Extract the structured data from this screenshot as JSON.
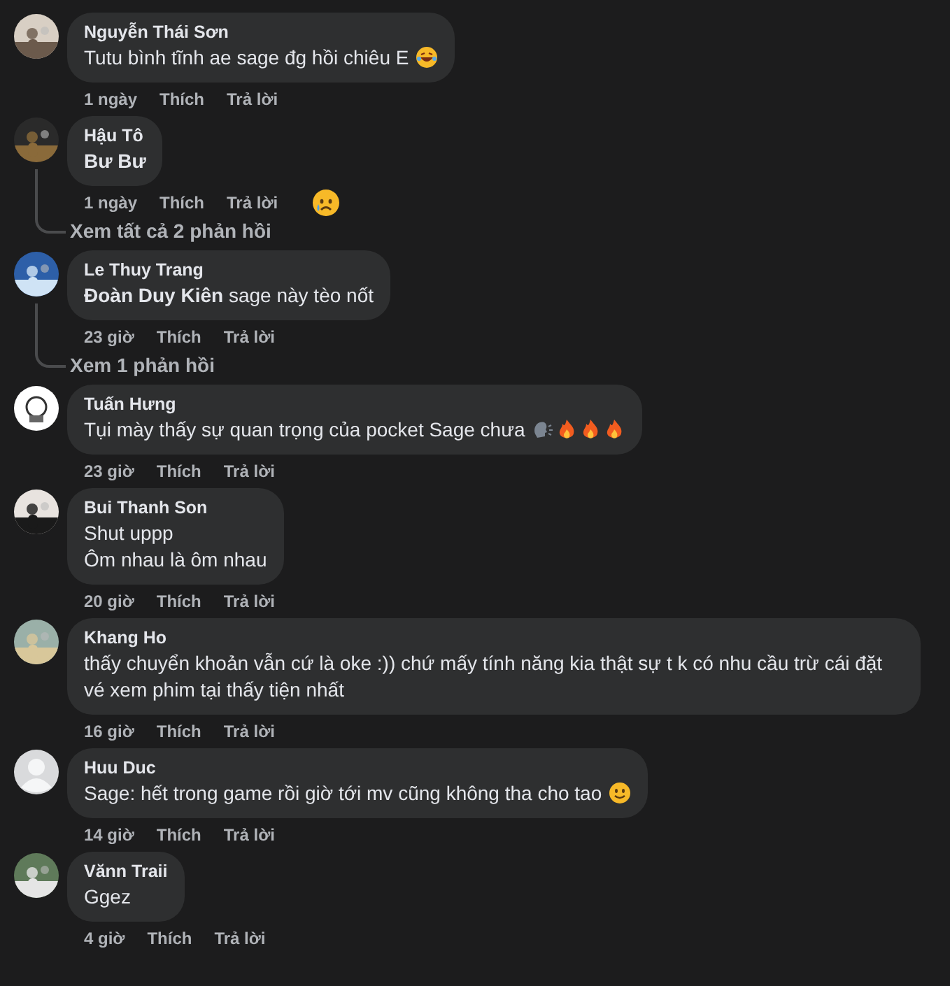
{
  "comments": [
    {
      "name": "Nguyễn Thái Sơn",
      "text": "Tutu bình tĩnh ae sage đg hồi chiêu E",
      "text_bold": false,
      "emojis": [
        {
          "kind": "laugh"
        }
      ],
      "time": "1 ngày",
      "like": "Thích",
      "reply": "Trả lời"
    },
    {
      "name": "Hậu Tô",
      "text": "Bư Bư",
      "text_bold": true,
      "time": "1 ngày",
      "like": "Thích",
      "reply": "Trả lời",
      "reaction": {
        "kind": "sad"
      },
      "replies_link": "Xem tất cả 2 phản hồi"
    },
    {
      "name": "Le Thuy Trang",
      "text": "**Đoàn Duy Kiên** sage này tèo nốt",
      "text_bold": false,
      "time": "23 giờ",
      "like": "Thích",
      "reply": "Trả lời",
      "replies_link": "Xem 1 phản hồi"
    },
    {
      "name": "Tuấn Hưng",
      "text": "Tụi mày thấy sự quan trọng của pocket Sage chưa",
      "text_bold": false,
      "emojis": [
        {
          "kind": "speak"
        },
        {
          "kind": "fire"
        },
        {
          "kind": "fire"
        },
        {
          "kind": "fire"
        }
      ],
      "time": "23 giờ",
      "like": "Thích",
      "reply": "Trả lời"
    },
    {
      "name": "Bui Thanh Son",
      "text": "Shut uppp\nÔm nhau là ôm nhau",
      "text_bold": false,
      "time": "20 giờ",
      "like": "Thích",
      "reply": "Trả lời"
    },
    {
      "name": "Khang Ho",
      "text": "thấy chuyển khoản vẫn cứ là oke :)) chứ mấy tính năng kia thật sự t k có nhu cầu trừ cái đặt vé xem phim tại thấy tiện nhất",
      "text_bold": false,
      "time": "16 giờ",
      "like": "Thích",
      "reply": "Trả lời"
    },
    {
      "name": "Huu Duc",
      "avatar": {
        "kind": "default"
      },
      "text": "Sage: hết trong game rồi giờ tới mv cũng không tha cho tao",
      "text_bold": false,
      "emojis": [
        {
          "kind": "smile"
        }
      ],
      "time": "14 giờ",
      "like": "Thích",
      "reply": "Trả lời"
    },
    {
      "name": "Vănn Traii",
      "text": "Ggez",
      "text_bold": false,
      "time": "4 giờ",
      "like": "Thích",
      "reply": "Trả lời"
    }
  ]
}
